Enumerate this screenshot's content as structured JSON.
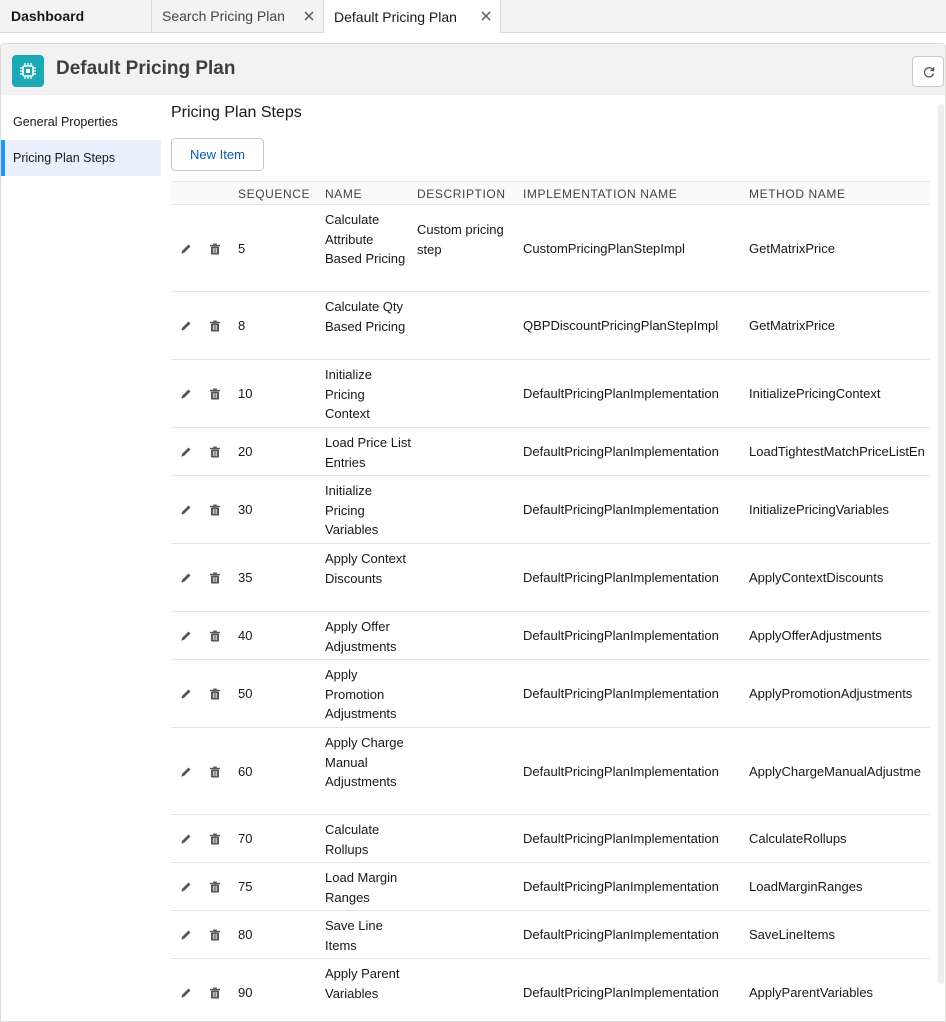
{
  "tabs": {
    "dashboard": "Dashboard",
    "search": "Search Pricing Plan",
    "active": "Default Pricing Plan"
  },
  "header": {
    "title": "Default Pricing Plan"
  },
  "sidenav": {
    "items": [
      {
        "label": "General Properties"
      },
      {
        "label": "Pricing Plan Steps"
      }
    ]
  },
  "main": {
    "section_title": "Pricing Plan Steps",
    "new_item_label": "New Item",
    "columns": [
      "SEQUENCE",
      "NAME",
      "DESCRIPTION",
      "IMPLEMENTATION NAME",
      "METHOD NAME"
    ],
    "rows": [
      {
        "sequence": "5",
        "name": "Calculate Attribute Based Pricing",
        "description": "Custom pricing step",
        "implementation": "CustomPricingPlanStepImpl",
        "method": "GetMatrixPrice"
      },
      {
        "sequence": "8",
        "name": "Calculate Qty Based Pricing",
        "description": "",
        "implementation": "QBPDiscountPricingPlanStepImpl",
        "method": "GetMatrixPrice"
      },
      {
        "sequence": "10",
        "name": "Initialize Pricing Context",
        "description": "",
        "implementation": "DefaultPricingPlanImplementation",
        "method": "InitializePricingContext"
      },
      {
        "sequence": "20",
        "name": "Load Price List Entries",
        "description": "",
        "implementation": "DefaultPricingPlanImplementation",
        "method": "LoadTightestMatchPriceListEn"
      },
      {
        "sequence": "30",
        "name": "Initialize Pricing Variables",
        "description": "",
        "implementation": "DefaultPricingPlanImplementation",
        "method": "InitializePricingVariables"
      },
      {
        "sequence": "35",
        "name": "Apply Context Discounts",
        "description": "",
        "implementation": "DefaultPricingPlanImplementation",
        "method": "ApplyContextDiscounts"
      },
      {
        "sequence": "40",
        "name": "Apply Offer Adjustments",
        "description": "",
        "implementation": "DefaultPricingPlanImplementation",
        "method": "ApplyOfferAdjustments"
      },
      {
        "sequence": "50",
        "name": "Apply Promotion Adjustments",
        "description": "",
        "implementation": "DefaultPricingPlanImplementation",
        "method": "ApplyPromotionAdjustments"
      },
      {
        "sequence": "60",
        "name": "Apply Charge Manual Adjustments",
        "description": "",
        "implementation": "DefaultPricingPlanImplementation",
        "method": "ApplyChargeManualAdjustme"
      },
      {
        "sequence": "70",
        "name": "Calculate Rollups",
        "description": "",
        "implementation": "DefaultPricingPlanImplementation",
        "method": "CalculateRollups"
      },
      {
        "sequence": "75",
        "name": "Load Margin Ranges",
        "description": "",
        "implementation": "DefaultPricingPlanImplementation",
        "method": "LoadMarginRanges"
      },
      {
        "sequence": "80",
        "name": "Save Line Items",
        "description": "",
        "implementation": "DefaultPricingPlanImplementation",
        "method": "SaveLineItems"
      },
      {
        "sequence": "90",
        "name": "Apply Parent Variables",
        "description": "",
        "implementation": "DefaultPricingPlanImplementation",
        "method": "ApplyParentVariables"
      }
    ]
  },
  "icons": {
    "app": "chip-icon",
    "refresh": "refresh-icon",
    "tab_close": "close-icon",
    "row_edit": "pencil-icon",
    "row_delete": "trash-icon"
  },
  "colors": {
    "accent": "#1aa9b5",
    "link": "#0b5cab",
    "selected_nav_bg": "#e8f1fb",
    "selected_nav_border": "#1b96ff"
  }
}
